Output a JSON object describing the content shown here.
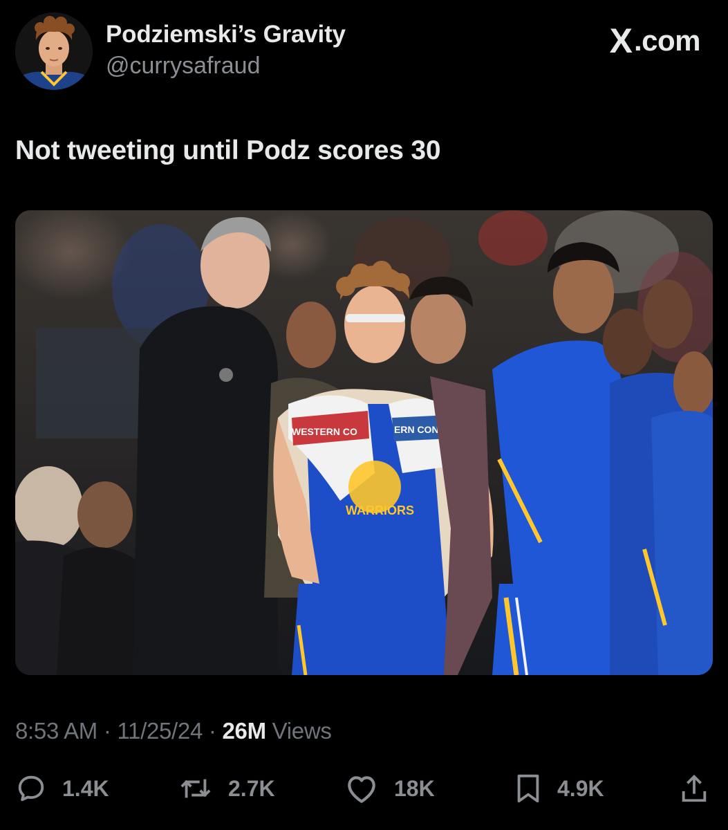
{
  "author": {
    "display_name": "Podziemski’s Gravity",
    "handle": "@currysafraud",
    "avatar_icon": "profile-photo"
  },
  "brand": {
    "logo": "X",
    "domain": ".com"
  },
  "tweet": {
    "text": "Not tweeting until Podz scores 30"
  },
  "media": {
    "description_icon": "photo",
    "jersey_text": "WARRIORS",
    "towel_text_1": "WESTERN CO",
    "towel_text_2": "ERN CONFE"
  },
  "meta": {
    "time": "8:53 AM",
    "sep1": " · ",
    "date": "11/25/24",
    "sep2": " · ",
    "views_count": "26M",
    "views_label": " Views"
  },
  "actions": {
    "replies": "1.4K",
    "reposts": "2.7K",
    "likes": "18K",
    "bookmarks": "4.9K"
  },
  "colors": {
    "background": "#000000",
    "text_primary": "#e7e9ea",
    "text_secondary": "#8b8f94",
    "warriors_blue": "#1d428a",
    "warriors_gold": "#ffc72c"
  }
}
